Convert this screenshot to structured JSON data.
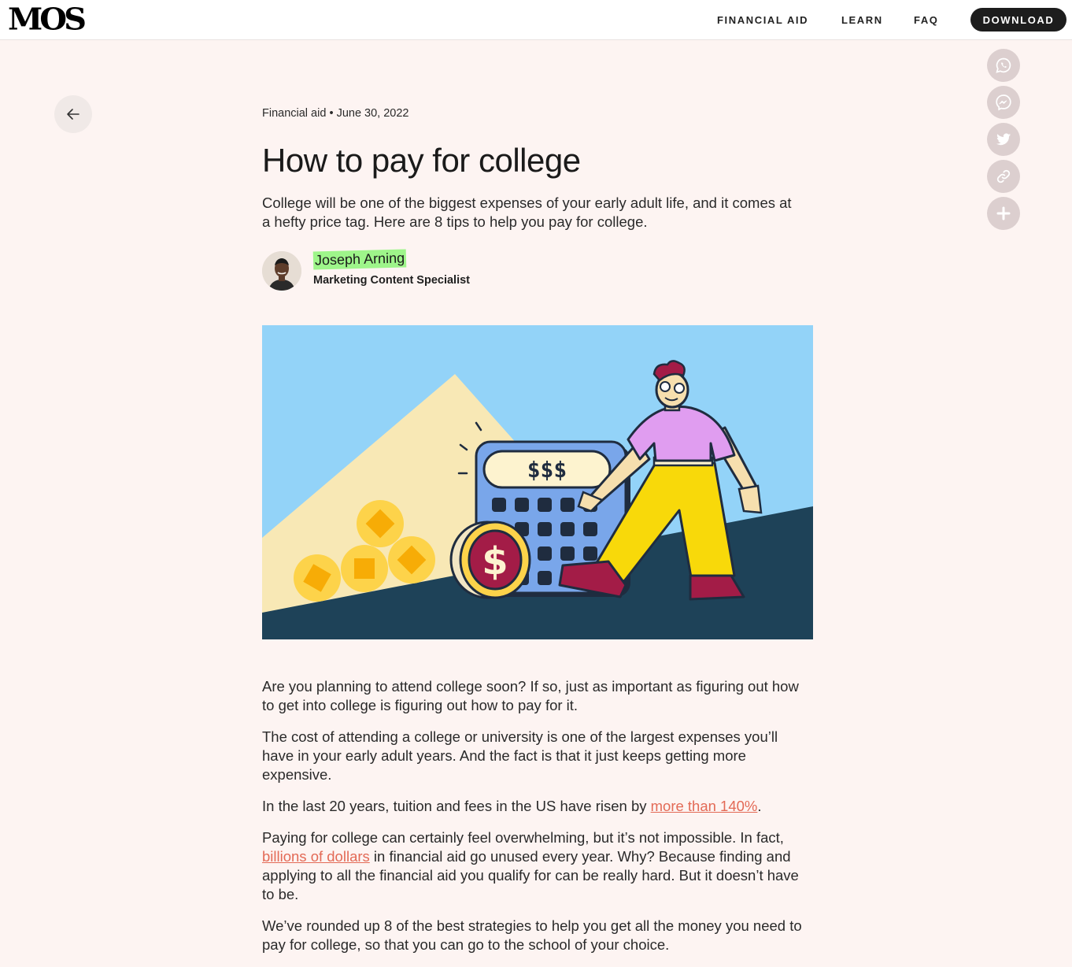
{
  "header": {
    "logo": "MOS",
    "nav": [
      "FINANCIAL AID",
      "LEARN",
      "FAQ"
    ],
    "download_label": "DOWNLOAD"
  },
  "article": {
    "category": "Financial aid",
    "date": "June 30, 2022",
    "title": "How to pay for college",
    "lede": "College will be one of the biggest expenses of your early adult life, and it comes at a hefty price tag. Here are 8 tips to help you pay for college.",
    "author": {
      "name": "Joseph Arning",
      "role": "Marketing Content Specialist"
    },
    "hero_text": "$$$",
    "paragraphs": [
      "Are you planning to attend college soon? If so, just as important as figuring out how to get into college is figuring out how to pay for it.",
      "The cost of attending a college or university is one of the largest expenses you’ll have in your early adult years. And the fact is that it just keeps getting more expensive."
    ],
    "p3": {
      "before": "In the last 20 years, tuition and fees in the US have risen by ",
      "link": "more than 140%",
      "after": "."
    },
    "p4": {
      "before": "Paying for college can certainly feel overwhelming, but it’s not impossible. In fact, ",
      "link": "billions of dollars",
      "after": " in financial aid go unused every year. Why? Because finding and applying to all the financial aid you qualify for can be really hard. But it doesn’t have to be."
    },
    "p5": "We’ve rounded up 8 of the best strategies to help you get all the money you need to pay for college, so that you can go to the school of your choice."
  },
  "share_icons": [
    "whatsapp-icon",
    "messenger-icon",
    "twitter-icon",
    "link-icon",
    "plus-icon"
  ],
  "colors": {
    "page_bg": "#fdf4f2",
    "link": "#e36a56",
    "highlight": "#9ef58a",
    "share_bg": "#dccfcf",
    "sky": "#93d3f8",
    "ground": "#1e4258"
  }
}
